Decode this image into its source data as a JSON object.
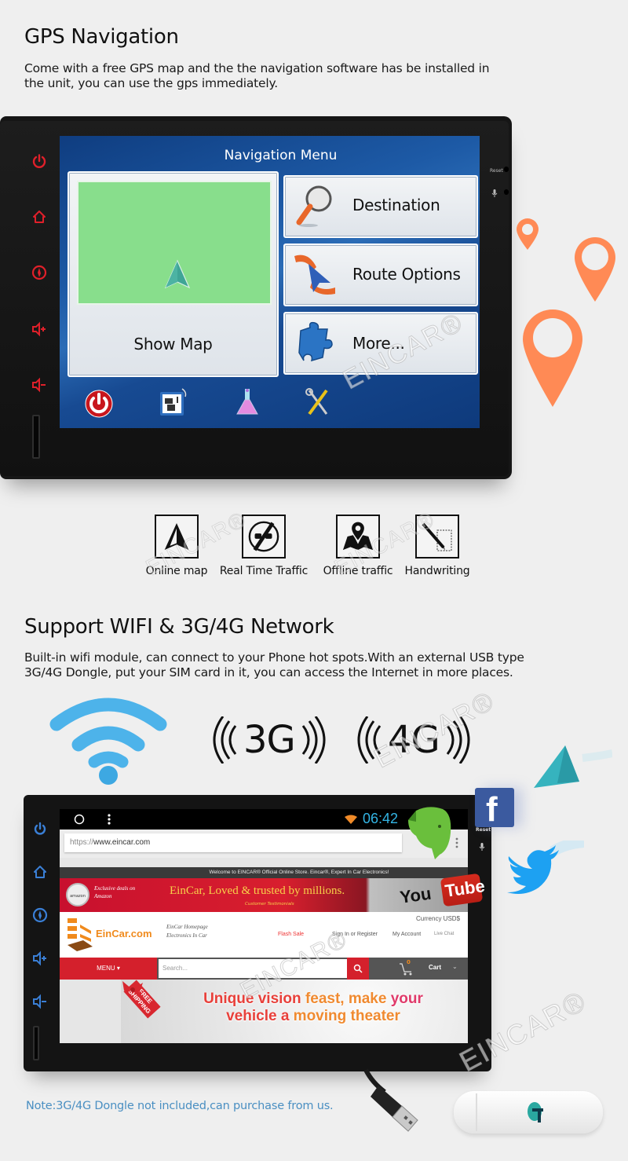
{
  "gps_section": {
    "title": "GPS Navigation",
    "description_line1": "Come with a free GPS map and the the navigation software has be installed in",
    "description_line2": "the unit, you can use the gps immediately."
  },
  "gps_unit": {
    "side_buttons": [
      "power-icon",
      "home-icon",
      "navigation-icon",
      "volume-up-icon",
      "volume-down-icon"
    ],
    "side_button_color": "#e0202a",
    "right_labels": {
      "reset": "Reset",
      "mic": "mic-icon"
    },
    "screen": {
      "title": "Navigation Menu",
      "show_map_label": "Show Map",
      "menu_items": [
        {
          "label": "Destination",
          "icon": "magnifier-icon"
        },
        {
          "label": "Route Options",
          "icon": "route-icon"
        },
        {
          "label": "More...",
          "icon": "puzzle-icon"
        }
      ],
      "bottom_icons": [
        "power-icon",
        "traffic-info-icon",
        "flask-icon",
        "tools-icon"
      ]
    },
    "pin_color": "#ff8a55"
  },
  "features": [
    {
      "label": "Online map",
      "icon": "navigation-arrow-icon"
    },
    {
      "label": "Real Time Traffic",
      "icon": "no-overtaking-icon"
    },
    {
      "label": "Offline traffic",
      "icon": "map-pin-icon"
    },
    {
      "label": "Handwriting",
      "icon": "pen-icon"
    }
  ],
  "network_section": {
    "title": "Support WIFI & 3G/4G Network",
    "description_line1": "Built-in wifi module, can connect to your Phone hot spots.With an external USB type",
    "description_line2": "3G/4G Dongle, put your SIM card in it, you can access the Internet in more places.",
    "badges": [
      "3G",
      "4G"
    ],
    "wifi_color": "#4db3ea"
  },
  "browser_unit": {
    "side_button_color": "#3a7fd6",
    "right_labels": {
      "reset": "Reset"
    },
    "status_time": "06:42",
    "url": {
      "prefix": "https://",
      "host": "www.eincar.com"
    },
    "welcome_text": "Welcome to EINCAR® Official Online Store. Eincar®, Expert In Car Electronics!",
    "banner": {
      "amazon_text": "Exclusive deals on Amazon",
      "headline": "EinCar,  Loved & trusted by millions.",
      "subline": "Customer Testimonials"
    },
    "site": {
      "logo_text": "EinCar.com",
      "tagline1": "EinCar Homepage",
      "tagline2": "Electronics In Car",
      "currency": "Currency USD$",
      "links": [
        "Flash Sale",
        "Sign In or Register",
        "My Account",
        "Live Chat"
      ],
      "menu_label": "MENU",
      "search_placeholder": "Search...",
      "cart_label": "Cart",
      "cart_count": "0"
    },
    "promo": {
      "ribbon": "FREE SHIPPING",
      "line1_a": "Unique vision ",
      "line1_b": "feast, make ",
      "line1_c": "your",
      "line2_a": "vehicle a ",
      "line2_b": "moving theater"
    },
    "youtube_label_a": "You",
    "youtube_label_b": "Tube"
  },
  "watermark": "EINCAR®",
  "note": "Note:3G/4G Dongle not included,can purchase from us."
}
